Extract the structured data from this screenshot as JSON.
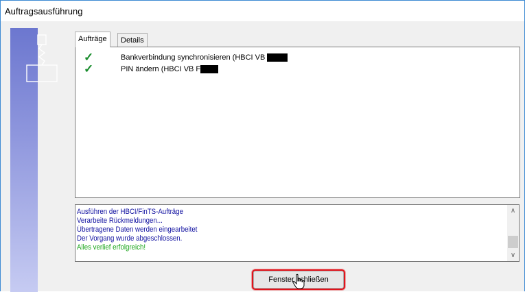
{
  "window": {
    "title": "Auftragsausführung"
  },
  "tabs": [
    {
      "label": "Aufträge",
      "active": true
    },
    {
      "label": "Details",
      "active": false
    }
  ],
  "tasks": [
    {
      "status_icon": "check-icon",
      "label": "Bankverbindung synchronisieren (HBCI VB "
    },
    {
      "status_icon": "check-icon",
      "label": "PIN ändern (HBCI VB F"
    }
  ],
  "log": {
    "lines": [
      {
        "text": "Ausführen der HBCI/FinTS-Aufträge",
        "color": "#1010a0"
      },
      {
        "text": "Verarbeite Rückmeldungen...",
        "color": "#1010a0"
      },
      {
        "text": "Übertragene Daten werden eingearbeitet",
        "color": "#1010a0"
      },
      {
        "text": "Der Vorgang wurde abgeschlossen.",
        "color": "#1010a0"
      },
      {
        "text": "Alles verlief erfolgreich!",
        "color": "#17a417"
      }
    ]
  },
  "buttons": {
    "close_label": "Fenster schließen"
  },
  "colors": {
    "highlight": "#e1131b",
    "success": "#17a417",
    "info": "#1010a0"
  }
}
